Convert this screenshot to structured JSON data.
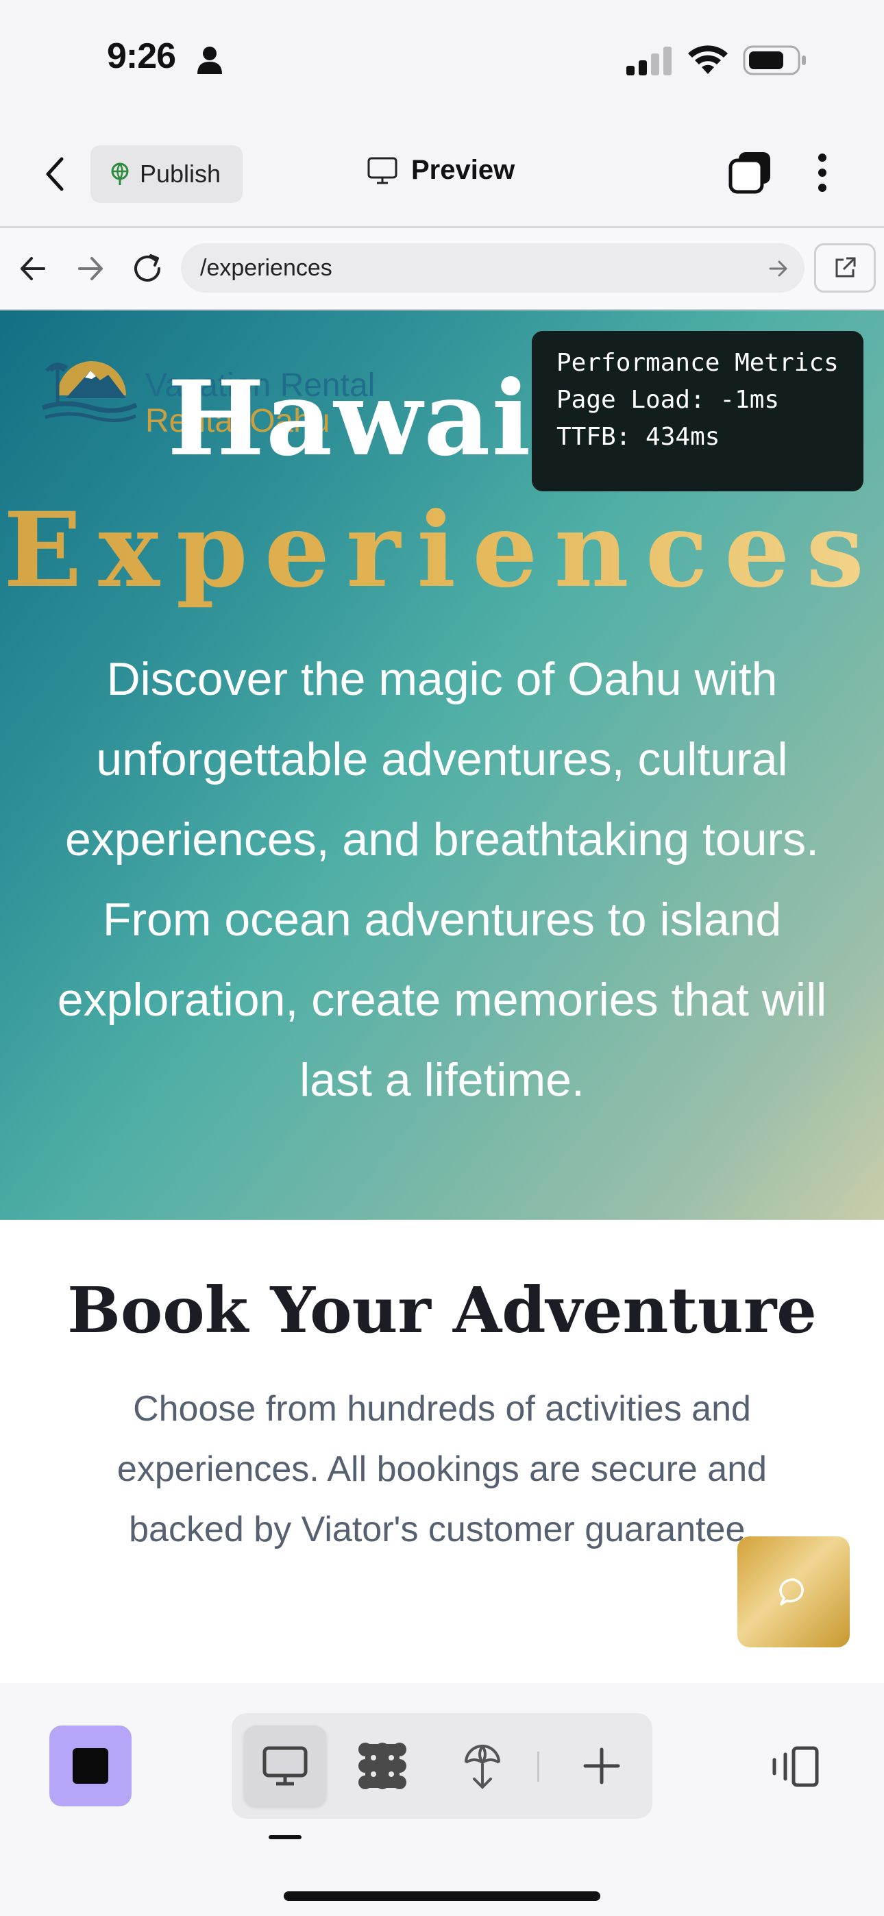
{
  "status_bar": {
    "time": "9:26"
  },
  "toolbar": {
    "publish_label": "Publish",
    "preview_label": "Preview"
  },
  "browser": {
    "url": "/experiences"
  },
  "hero": {
    "logo_line1": "Vacation Rental",
    "logo_line2": "Rental Oahu",
    "title_line1": "Hawaiian",
    "title_line2": "Experiences",
    "description": "Discover the magic of Oahu with unforgettable adventures, cultural experiences, and breathtaking tours. From ocean adventures to island exploration, create memories that will last a lifetime."
  },
  "performance": {
    "title": "Performance Metrics",
    "page_load": "Page Load: -1ms",
    "ttfb": "TTFB: 434ms"
  },
  "book": {
    "title": "Book Your Adventure",
    "description": "Choose from hundreds of activities and experiences. All bookings are secure and backed by Viator's customer guarantee."
  },
  "colors": {
    "accent_gold": "#d9aa4a",
    "hero_teal": "#2e8f97",
    "stop_button": "#b7a6f7"
  },
  "icons": [
    "person-icon",
    "signal-icon",
    "wifi-icon",
    "battery-icon",
    "back-chevron-icon",
    "globe-icon",
    "monitor-icon",
    "tabs-icon",
    "more-icon",
    "arrow-left-icon",
    "arrow-right-icon",
    "reload-icon",
    "external-link-icon",
    "menu-icon",
    "chat-icon",
    "stop-icon",
    "desktop-icon",
    "grid-icon",
    "tree-icon",
    "plus-icon",
    "device-panel-icon"
  ]
}
